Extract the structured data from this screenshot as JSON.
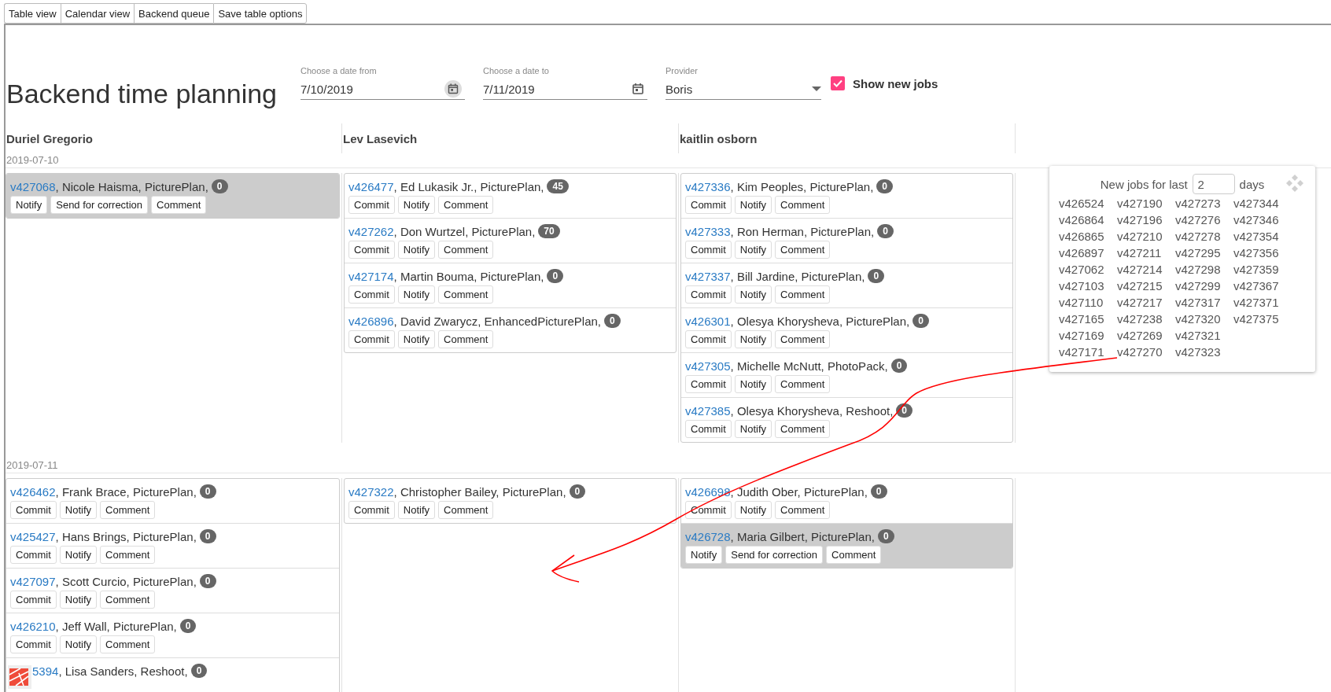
{
  "toolbar_buttons": [
    "Table view",
    "Calendar view",
    "Backend queue",
    "Save table options"
  ],
  "title": "Backend time planning",
  "filters": {
    "date_from": {
      "label": "Choose a date from",
      "value": "7/10/2019"
    },
    "date_to": {
      "label": "Choose a date to",
      "value": "7/11/2019"
    },
    "provider": {
      "label": "Provider",
      "value": "Boris"
    },
    "show_new_jobs": {
      "label": "Show new jobs",
      "checked": true
    }
  },
  "columns": [
    "Duriel Gregorio",
    "Lev Lasevich",
    "kaitlin osborn"
  ],
  "days": [
    {
      "date": "2019-07-10",
      "cells": [
        [
          {
            "id": "v427068",
            "text": ", Nicole Haisma, PicturePlan,",
            "count": "0",
            "highlighted": true,
            "actions": [
              "Notify",
              "Send for correction",
              "Comment"
            ]
          }
        ],
        [
          {
            "id": "v426477",
            "text": ", Ed Lukasik Jr., PicturePlan,",
            "count": "45",
            "highlighted": false,
            "actions": [
              "Commit",
              "Notify",
              "Comment"
            ]
          },
          {
            "id": "v427262",
            "text": ", Don Wurtzel, PicturePlan,",
            "count": "70",
            "highlighted": false,
            "actions": [
              "Commit",
              "Notify",
              "Comment"
            ]
          },
          {
            "id": "v427174",
            "text": ", Martin Bouma, PicturePlan,",
            "count": "0",
            "highlighted": false,
            "actions": [
              "Commit",
              "Notify",
              "Comment"
            ]
          },
          {
            "id": "v426896",
            "text": ", David Zwarycz, EnhancedPicturePlan,",
            "count": "0",
            "highlighted": false,
            "actions": [
              "Commit",
              "Notify",
              "Comment"
            ]
          }
        ],
        [
          {
            "id": "v427336",
            "text": ", Kim Peoples, PicturePlan,",
            "count": "0",
            "highlighted": false,
            "actions": [
              "Commit",
              "Notify",
              "Comment"
            ]
          },
          {
            "id": "v427333",
            "text": ", Ron Herman, PicturePlan,",
            "count": "0",
            "highlighted": false,
            "actions": [
              "Commit",
              "Notify",
              "Comment"
            ]
          },
          {
            "id": "v427337",
            "text": ", Bill Jardine, PicturePlan,",
            "count": "0",
            "highlighted": false,
            "actions": [
              "Commit",
              "Notify",
              "Comment"
            ]
          },
          {
            "id": "v426301",
            "text": ", Olesya Khorysheva, PicturePlan,",
            "count": "0",
            "highlighted": false,
            "actions": [
              "Commit",
              "Notify",
              "Comment"
            ]
          },
          {
            "id": "v427305",
            "text": ", Michelle McNutt, PhotoPack,",
            "count": "0",
            "highlighted": false,
            "actions": [
              "Commit",
              "Notify",
              "Comment"
            ]
          },
          {
            "id": "v427385",
            "text": ", Olesya Khorysheva, Reshoot,",
            "count": "0",
            "highlighted": false,
            "actions": [
              "Commit",
              "Notify",
              "Comment"
            ]
          }
        ]
      ]
    },
    {
      "date": "2019-07-11",
      "cells": [
        [
          {
            "id": "v426462",
            "text": ", Frank Brace, PicturePlan,",
            "count": "0",
            "highlighted": false,
            "actions": [
              "Commit",
              "Notify",
              "Comment"
            ]
          },
          {
            "id": "v425427",
            "text": ", Hans Brings, PicturePlan,",
            "count": "0",
            "highlighted": false,
            "actions": [
              "Commit",
              "Notify",
              "Comment"
            ]
          },
          {
            "id": "v427097",
            "text": ", Scott Curcio, PicturePlan,",
            "count": "0",
            "highlighted": false,
            "actions": [
              "Commit",
              "Notify",
              "Comment"
            ]
          },
          {
            "id": "v426210",
            "text": ", Jeff Wall, PicturePlan,",
            "count": "0",
            "highlighted": false,
            "actions": [
              "Commit",
              "Notify",
              "Comment"
            ]
          },
          {
            "id": "5394",
            "text": ", Lisa Sanders, Reshoot,",
            "count": "0",
            "highlighted": false,
            "covered": true
          }
        ],
        [
          {
            "id": "v427322",
            "text": ", Christopher Bailey, PicturePlan,",
            "count": "0",
            "highlighted": false,
            "actions": [
              "Commit",
              "Notify",
              "Comment"
            ]
          }
        ],
        [
          {
            "id": "v426698",
            "text": ", Judith Ober, PicturePlan,",
            "count": "0",
            "highlighted": false,
            "actions": [
              "Commit",
              "Notify",
              "Comment"
            ]
          },
          {
            "id": "v426728",
            "text": ", Maria Gilbert, PicturePlan,",
            "count": "0",
            "highlighted": true,
            "actions": [
              "Notify",
              "Send for correction",
              "Comment"
            ]
          }
        ]
      ]
    }
  ],
  "new_jobs_panel": {
    "label": "New jobs for last",
    "days_value": "2",
    "suffix": "days",
    "jobs": [
      "v426524",
      "v426864",
      "v426865",
      "v426897",
      "v427062",
      "v427103",
      "v427110",
      "v427165",
      "v427169",
      "v427171",
      "v427190",
      "v427196",
      "v427210",
      "v427211",
      "v427214",
      "v427215",
      "v427217",
      "v427238",
      "v427269",
      "v427270",
      "v427273",
      "v427276",
      "v427278",
      "v427295",
      "v427298",
      "v427299",
      "v427317",
      "v427320",
      "v427321",
      "v427323",
      "v427344",
      "v427346",
      "v427354",
      "v427356",
      "v427359",
      "v427367",
      "v427371",
      "v427375"
    ]
  }
}
